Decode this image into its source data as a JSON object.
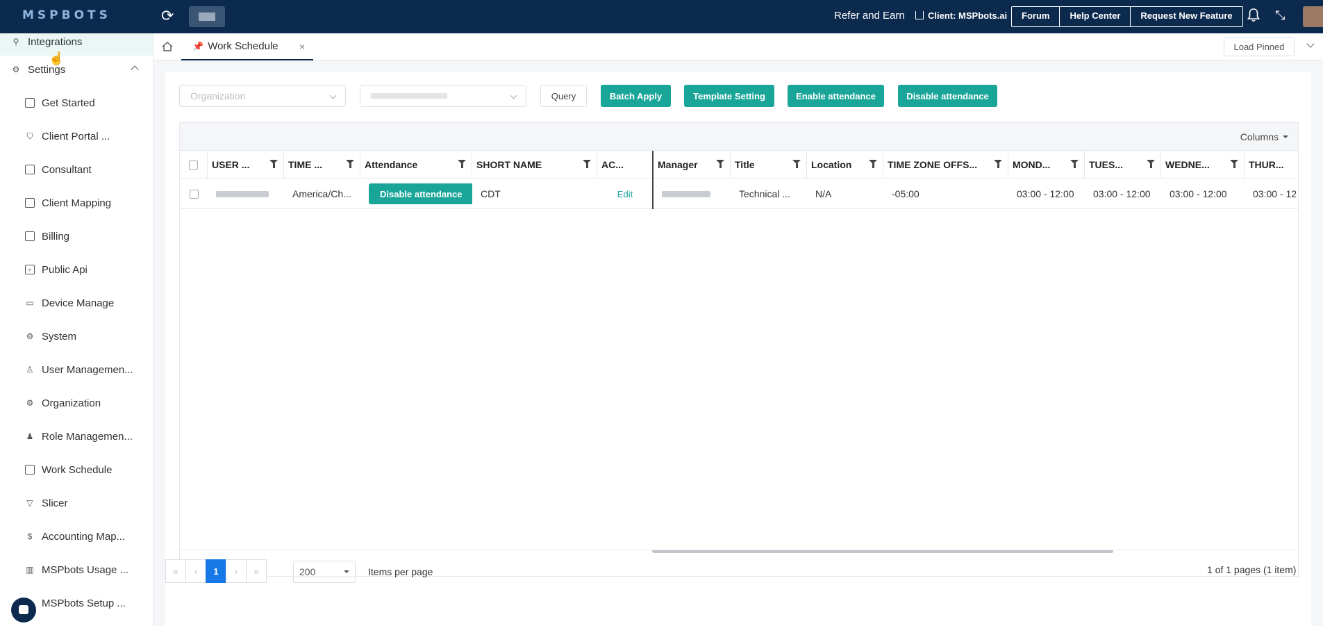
{
  "topbar": {
    "logo": "MSPBOTS",
    "refer": "Refer and Earn",
    "client": "Client: MSPbots.ai",
    "buttons": [
      "Forum",
      "Help Center",
      "Request New Feature"
    ]
  },
  "sidebar": {
    "integrations": "Integrations",
    "settings": "Settings",
    "items": [
      {
        "label": "Get Started",
        "icon": "chart-icon"
      },
      {
        "label": "Client Portal ...",
        "icon": "shield-icon"
      },
      {
        "label": "Consultant",
        "icon": "document-icon"
      },
      {
        "label": "Client Mapping",
        "icon": "list-icon"
      },
      {
        "label": "Billing",
        "icon": "billing-icon"
      },
      {
        "label": "Public Api",
        "icon": "api-icon"
      },
      {
        "label": "Device Manage",
        "icon": "monitor-icon"
      },
      {
        "label": "System",
        "icon": "gear-icon"
      },
      {
        "label": "User Managemen...",
        "icon": "user-icon"
      },
      {
        "label": "Organization",
        "icon": "gear-icon"
      },
      {
        "label": "Role Managemen...",
        "icon": "users-icon"
      },
      {
        "label": "Work Schedule",
        "icon": "calendar-icon"
      },
      {
        "label": "Slicer",
        "icon": "filter-icon"
      },
      {
        "label": "Accounting Map...",
        "icon": "dollar-icon"
      },
      {
        "label": "MSPbots Usage ...",
        "icon": "bar-chart-icon"
      },
      {
        "label": "MSPbots Setup ...",
        "icon": "setup-icon"
      }
    ]
  },
  "tabs": {
    "active": "Work Schedule",
    "load_pinned": "Load Pinned"
  },
  "filters": {
    "organization_placeholder": "Organization",
    "query": "Query",
    "batch_apply": "Batch Apply",
    "template_setting": "Template Setting",
    "enable_attendance": "Enable attendance",
    "disable_attendance": "Disable attendance"
  },
  "grid": {
    "columns_label": "Columns",
    "headers": [
      "USER ...",
      "TIME ...",
      "Attendance",
      "SHORT NAME",
      "AC...",
      "Manager",
      "Title",
      "Location",
      "TIME ZONE OFFS...",
      "MOND...",
      "TUES...",
      "WEDNE...",
      "THUR..."
    ],
    "rows": [
      {
        "time": "America/Ch...",
        "attendance_btn": "Disable attendance",
        "short_name": "CDT",
        "action": "Edit",
        "title": "Technical ...",
        "location": "N/A",
        "tz_offset": "-05:00",
        "monday": "03:00 - 12:00",
        "tuesday": "03:00 - 12:00",
        "wednesday": "03:00 - 12:00",
        "thursday": "03:00 - 12"
      }
    ]
  },
  "pagination": {
    "first": "«",
    "prev": "‹",
    "current": "1",
    "next": "›",
    "last": "»",
    "per_page": "200",
    "items_per_page": "Items per page",
    "info": "1 of 1 pages (1 item)"
  },
  "colors": {
    "topbar": "#0c2a4e",
    "accent": "#1aa599",
    "page_active": "#1677e6"
  }
}
